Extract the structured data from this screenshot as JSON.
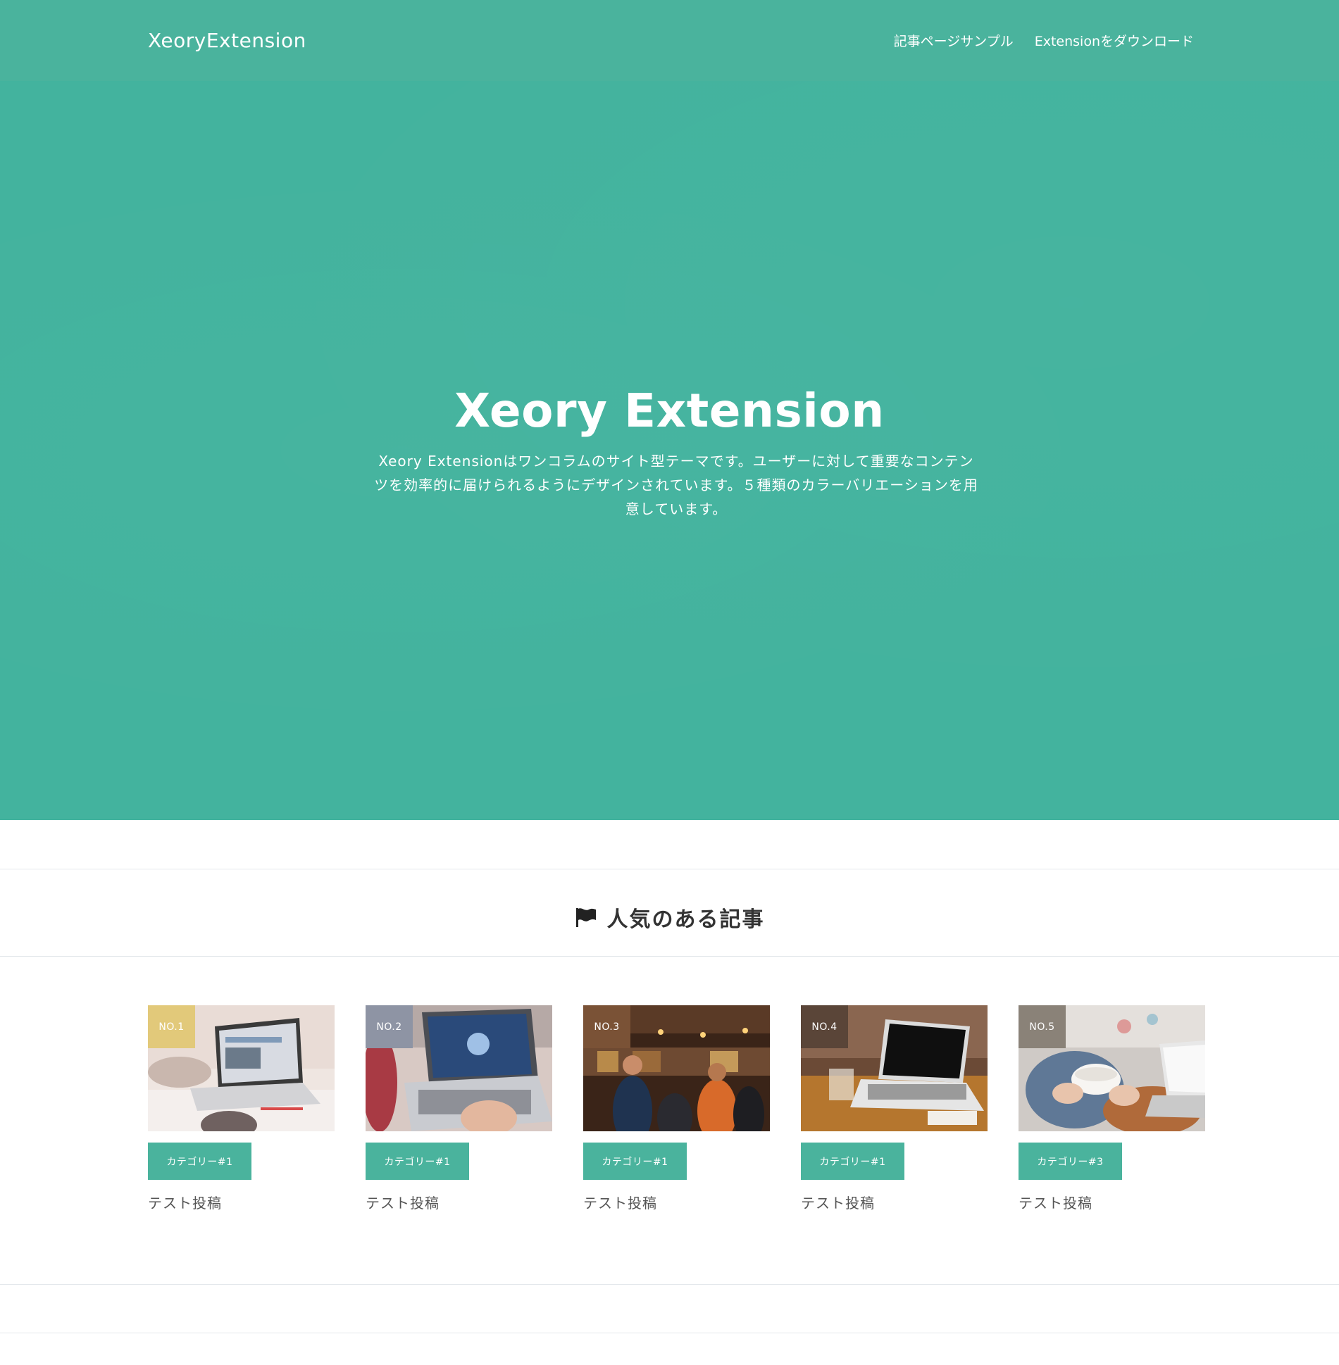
{
  "header": {
    "logo": "XeoryExtension",
    "nav": [
      {
        "label": "記事ページサンプル"
      },
      {
        "label": "Extensionをダウンロード"
      }
    ]
  },
  "hero": {
    "title": "Xeory Extension",
    "description": "Xeory Extensionはワンコラムのサイト型テーマです。ユーザーに対して重要なコンテンツを効率的に届けられるようにデザインされています。５種類のカラーバリエーションを用意しています。"
  },
  "popular": {
    "heading": "人気のある記事",
    "icon": "flag-icon",
    "posts": [
      {
        "rank": "NO.1",
        "badge_color": "#e2c97a",
        "category": "カテゴリー#1",
        "title": "テスト投稿"
      },
      {
        "rank": "NO.2",
        "badge_color": "#8e94a4",
        "category": "カテゴリー#1",
        "title": "テスト投稿"
      },
      {
        "rank": "NO.3",
        "badge_color": "#7a5236",
        "category": "カテゴリー#1",
        "title": "テスト投稿"
      },
      {
        "rank": "NO.4",
        "badge_color": "#5a4538",
        "category": "カテゴリー#1",
        "title": "テスト投稿"
      },
      {
        "rank": "NO.5",
        "badge_color": "#8a8278",
        "category": "カテゴリー#3",
        "title": "テスト投稿"
      }
    ]
  },
  "colors": {
    "accent": "#4ab39d",
    "hero_bg": "#43b39e"
  }
}
